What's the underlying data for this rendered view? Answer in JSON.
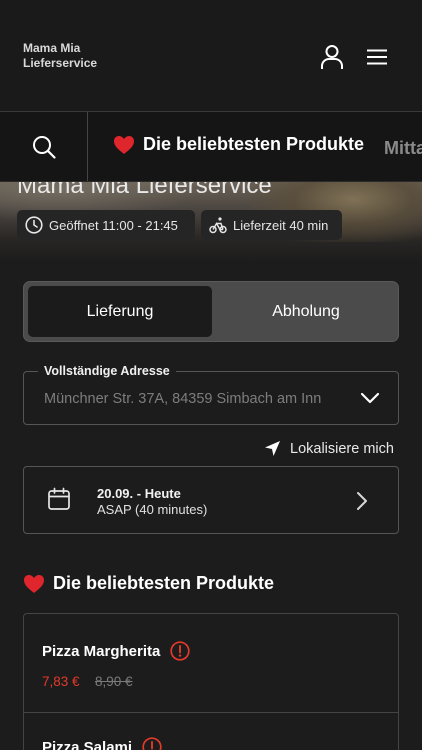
{
  "header": {
    "brand_line1": "Mama Mia",
    "brand_line2": "Lieferservice",
    "user_icon": "user-icon",
    "menu_icon": "hamburger-menu-icon"
  },
  "category_bar": {
    "search_icon": "search-icon",
    "active_category": "Die beliebtesten Produkte",
    "next_category": "Mitta"
  },
  "hero": {
    "title": "Mama Mia Lieferservice",
    "opening_hours": "Geöffnet 11:00 - 21:45",
    "delivery_time": "Lieferzeit 40 min"
  },
  "order_type": {
    "options": [
      "Lieferung",
      "Abholung"
    ],
    "selected": "Lieferung"
  },
  "address": {
    "label": "Vollständige Adresse",
    "placeholder": "Münchner Str. 37A, 84359 Simbach am Inn",
    "locate_label": "Lokalisiere mich"
  },
  "delivery_slot": {
    "date": "20.09. - Heute",
    "time": "ASAP (40 minutes)"
  },
  "popular": {
    "title": "Die beliebtesten Produkte",
    "products": [
      {
        "name": "Pizza Margherita",
        "price": "7,83 €",
        "old_price": "8,90 €"
      },
      {
        "name": "Pizza Salami"
      }
    ]
  },
  "colors": {
    "background": "#1c1c1c",
    "accent_red": "#e23a2a",
    "heart": "#e0262d"
  }
}
